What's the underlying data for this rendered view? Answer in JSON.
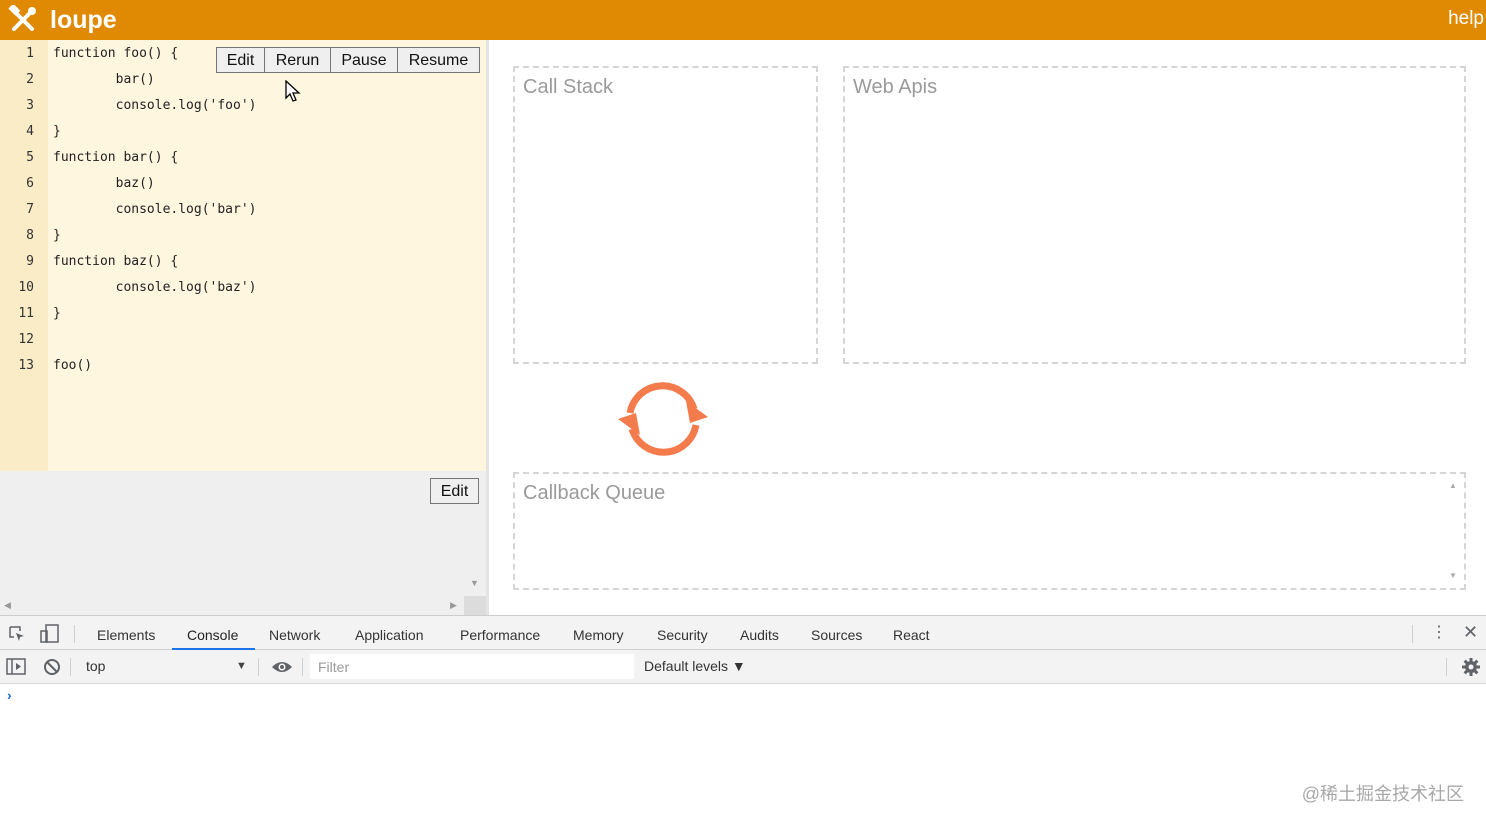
{
  "header": {
    "logo": "loupe",
    "help": "help",
    "background": "#e08a04"
  },
  "toolbar": {
    "edit": "Edit",
    "rerun": "Rerun",
    "pause": "Pause",
    "resume": "Resume"
  },
  "code": {
    "lines": [
      {
        "n": "1",
        "text": "function foo() {"
      },
      {
        "n": "2",
        "text": "        bar()"
      },
      {
        "n": "3",
        "text": "        console.log('foo')"
      },
      {
        "n": "4",
        "text": "}"
      },
      {
        "n": "5",
        "text": "function bar() {"
      },
      {
        "n": "6",
        "text": "        baz()"
      },
      {
        "n": "7",
        "text": "        console.log('bar')"
      },
      {
        "n": "8",
        "text": "}"
      },
      {
        "n": "9",
        "text": "function baz() {"
      },
      {
        "n": "10",
        "text": "        console.log('baz')"
      },
      {
        "n": "11",
        "text": "}"
      },
      {
        "n": "12",
        "text": ""
      },
      {
        "n": "13",
        "text": "foo()"
      }
    ]
  },
  "console_panel": {
    "edit": "Edit"
  },
  "visualizer": {
    "call_stack": "Call Stack",
    "web_apis": "Web Apis",
    "callback_queue": "Callback Queue",
    "accent": "#f47c4c"
  },
  "devtools": {
    "tabs": [
      "Elements",
      "Console",
      "Network",
      "Application",
      "Performance",
      "Memory",
      "Security",
      "Audits",
      "Sources",
      "React"
    ],
    "active_tab": "Console",
    "context": "top",
    "filter_placeholder": "Filter",
    "levels": "Default levels ▼",
    "prompt": "›"
  },
  "watermark": "@稀土掘金技术社区"
}
